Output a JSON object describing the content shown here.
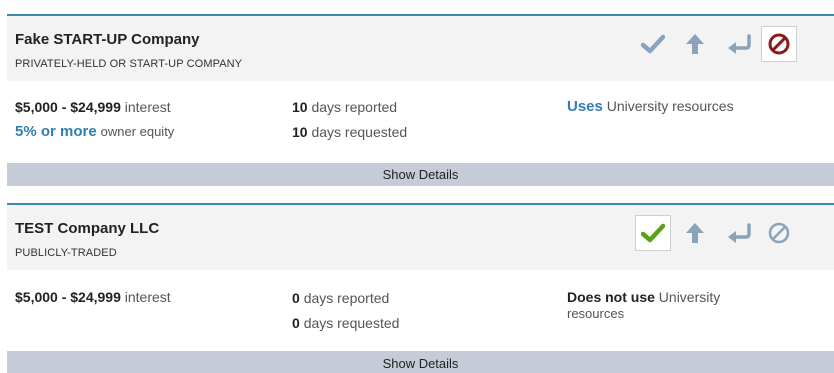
{
  "colors": {
    "accent_border": "#3a8ab0",
    "link_blue": "#2f7fb0",
    "icon_gray": "#8aa3bb",
    "check_green": "#5ca11a",
    "decline_red": "#8b1a1a",
    "details_bar": "#c5ccd7"
  },
  "cards": [
    {
      "name": "Fake START-UP Company",
      "type": "PRIVATELY-HELD OR START-UP COMPANY",
      "interest_amount": "$5,000 - $24,999",
      "interest_suffix": "interest",
      "equity_amount": "5% or more",
      "equity_suffix": "owner equity",
      "days_reported_num": "10",
      "days_reported_label": "days reported",
      "days_requested_num": "10",
      "days_requested_label": "days requested",
      "resources_strong": "Uses",
      "resources_text": "University resources",
      "details_label": "Show Details",
      "actions": [
        "approve-check-icon",
        "move-up-arrow-icon",
        "return-arrow-icon",
        "decline-circle-icon"
      ],
      "selected_action": "decline"
    },
    {
      "name": "TEST Company LLC",
      "type": "PUBLICLY-TRADED",
      "interest_amount": "$5,000 - $24,999",
      "interest_suffix": "interest",
      "days_reported_num": "0",
      "days_reported_label": "days reported",
      "days_requested_num": "0",
      "days_requested_label": "days requested",
      "resources_strong": "Does not use",
      "resources_text": "University",
      "resources_text2": "resources",
      "details_label": "Show Details",
      "actions": [
        "approve-check-icon",
        "move-up-arrow-icon",
        "return-arrow-icon",
        "decline-circle-icon"
      ],
      "selected_action": "approve"
    }
  ]
}
